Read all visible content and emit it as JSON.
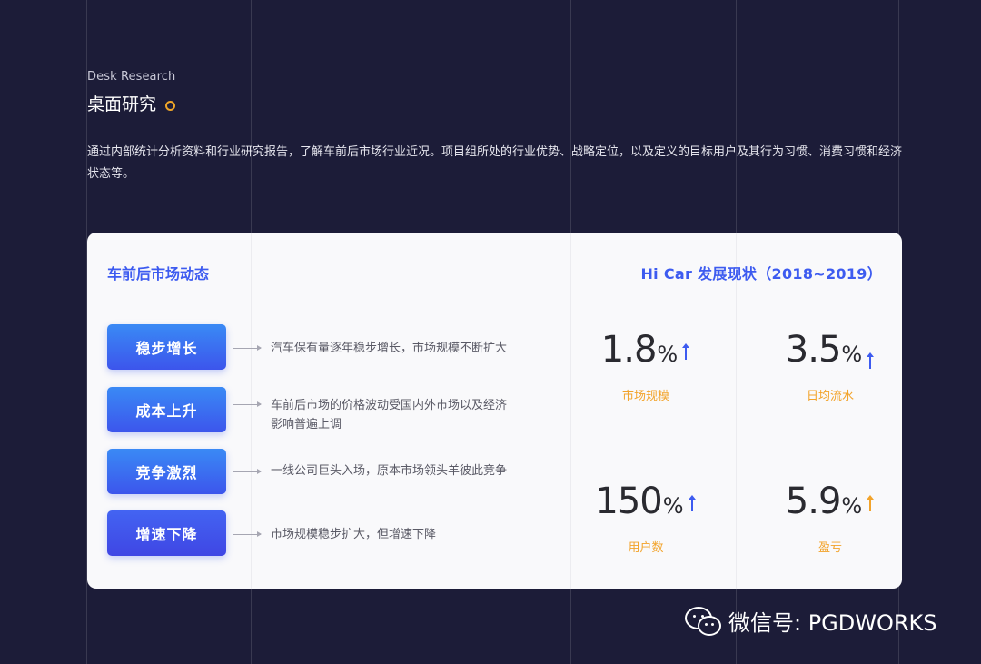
{
  "header": {
    "eyebrow": "Desk Research",
    "title": "桌面研究",
    "intro": "通过内部统计分析资料和行业研究报告，了解车前后市场行业近况。项目组所处的行业优势、战略定位，以及定义的目标用户及其行为习惯、消费习惯和经济状态等。"
  },
  "market": {
    "title": "车前后市场动态",
    "items": [
      {
        "label": "稳步增长",
        "desc": "汽车保有量逐年稳步增长，市场规模不断扩大"
      },
      {
        "label": "成本上升",
        "desc": "车前后市场的价格波动受国内外市场以及经济影响普遍上调"
      },
      {
        "label": "竞争激烈",
        "desc": "一线公司巨头入场，原本市场领头羊彼此竞争"
      },
      {
        "label": "增速下降",
        "desc": "市场规模稳步扩大，但增速下降"
      }
    ]
  },
  "hicar": {
    "title": "Hi Car 发展现状（2018~2019）",
    "stats": [
      {
        "value": "1.8",
        "unit": "%",
        "label": "市场规模",
        "arrow_color": "#3d5bf0"
      },
      {
        "value": "3.5",
        "unit": "%",
        "label": "日均流水",
        "arrow_color": "#3d5bf0"
      },
      {
        "value": "150",
        "unit": "%",
        "label": "用户数",
        "arrow_color": "#3d5bf0"
      },
      {
        "value": "5.9",
        "unit": "%",
        "label": "盈亏",
        "arrow_color": "#f2a32a"
      }
    ]
  },
  "watermark": {
    "icon": "wechat-icon",
    "text": "微信号: PGDWORKS"
  },
  "colors": {
    "background": "#1c1c38",
    "accent_blue": "#3d5bf0",
    "accent_orange": "#f2a32a"
  }
}
